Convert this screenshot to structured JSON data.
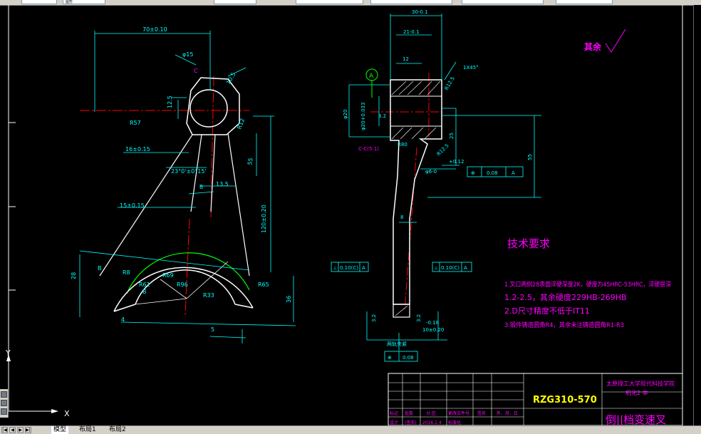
{
  "app": {
    "title_fragment": "图形"
  },
  "colors": {
    "background": "#000000",
    "dimension": "#00ffff",
    "outline": "#ffffff",
    "center": "#ff0000",
    "note": "#ff00ff",
    "green": "#00ff00",
    "frame": "#ffffff",
    "titleblock_text": "#ff00ff",
    "partno_text": "#ffff00"
  },
  "icons": {
    "ucs": "ucs-icon",
    "nav": [
      "first-tab-icon",
      "prev-tab-icon",
      "next-tab-icon",
      "last-tab-icon"
    ]
  },
  "ucs": {
    "y": "Y",
    "x": "X"
  },
  "layout_tabs": {
    "model": "模型",
    "layout1": "布局1",
    "layout2": "布局2"
  },
  "roughness_note": "其余",
  "left_view": {
    "dims": {
      "d70": "70±0.10",
      "phi15": "φ15",
      "c": "C",
      "d12_5": "12.5",
      "d10_5": "10.5",
      "r57": "R57",
      "r12": "R12",
      "r125": "R12.5",
      "d55": "55",
      "d16": "16±0.15",
      "ang23": "23°0'±0°15'",
      "d13_5": "13.5",
      "d8": "8",
      "d15": "15±0.15",
      "d120": "120±0.20",
      "r8": "R8",
      "r69": "R69",
      "r61": "R61",
      "r96": "R96",
      "r33": "R33",
      "r65": "R65",
      "d28": "28",
      "d36": "36",
      "d4": "4",
      "d5": "5",
      "b1": "B",
      "b2": "B"
    }
  },
  "right_view": {
    "dims": {
      "d30": "30-0.1",
      "d21": "21-0.1",
      "d12": "12",
      "chamfer": "1X45°",
      "r125": "R12.5",
      "d25": "25",
      "d55": "55",
      "d6": "φ6-0",
      "d012": "+0.12",
      "datum_a": "A",
      "phi20": "φ20",
      "bore": "φ20+0.033",
      "r3_2": "3.2",
      "c_view": "C-C(5:1)",
      "r80": "R80",
      "d8": "8",
      "d3_2a": "3.2",
      "d3_2b": "3.2",
      "d0_18": "-0.18",
      "d10_020": "10±0.20",
      "section": "两轨夹紧"
    },
    "fcf": {
      "pos": [
        "⊕",
        "0.08",
        "A"
      ],
      "perp1": [
        "⊥",
        "0.10(C)",
        "A"
      ],
      "perp2": [
        "⊥",
        "0.10(C)",
        "A"
      ],
      "pos2": [
        "⊕",
        "0.08"
      ]
    }
  },
  "tech_req": {
    "title": "技术要求",
    "lines": [
      "1.叉口两侧28表面淬硬深度2K，硬度为45HRC-53HRC，淬硬层深",
      "1.2-2.5，其余硬度229HB-269HB",
      "2.D尺寸精度不低于IT11",
      "3.锻件铸造圆角R4，其余未注铸造圆角R1-R3"
    ]
  },
  "title_block": {
    "school": "太原理工大学现代科技学院",
    "sub": "机化2 本",
    "part_no": "RZG310-570",
    "part_name": "倒||档变速叉",
    "headers": [
      "标记",
      "处数",
      "分 区",
      "更改文件号",
      "签名",
      "年、月、日"
    ],
    "row": [
      "设计",
      "(签名)",
      "2016.1.4",
      "标准化"
    ]
  }
}
